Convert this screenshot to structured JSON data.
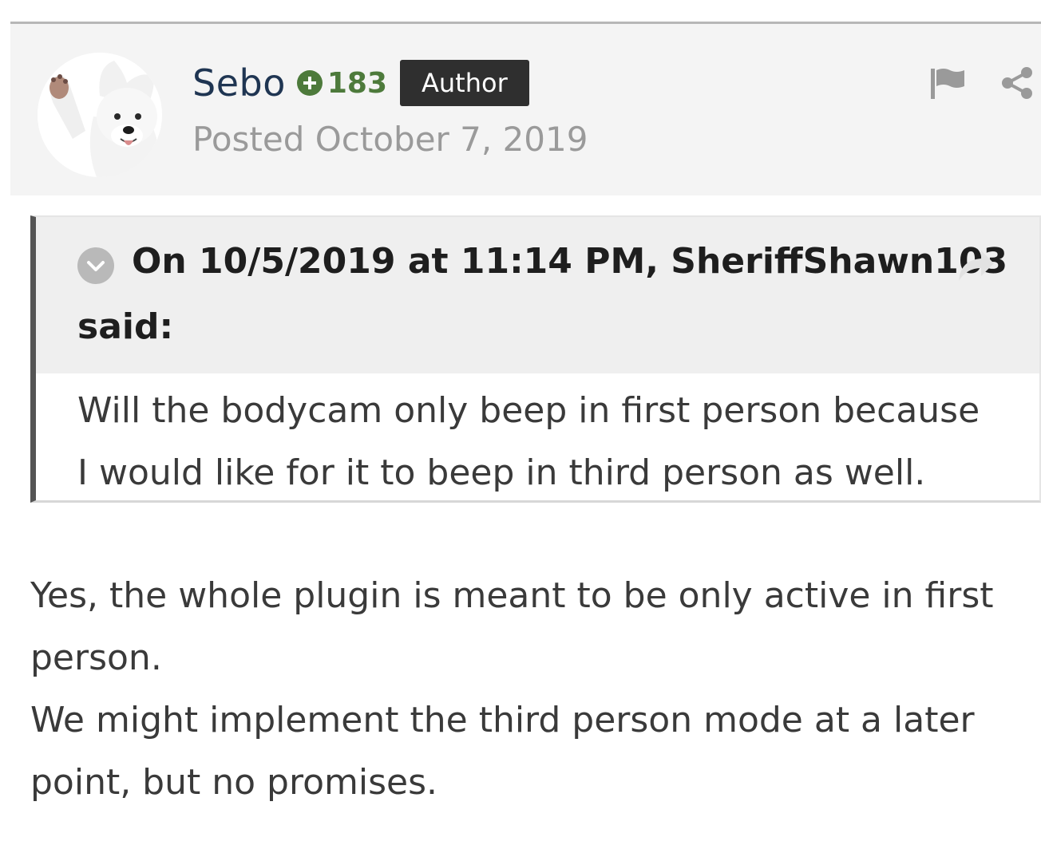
{
  "post": {
    "author": {
      "name": "Sebo",
      "reputation": "183",
      "badge": "Author",
      "avatar_icon": "samoyed-dog-avatar"
    },
    "posted_label": "Posted October 7, 2019",
    "actions": {
      "report_icon": "flag-icon",
      "share_icon": "share-icon"
    },
    "quote": {
      "citation_line1": "On 10/5/2019 at 11:14 PM, SheriffShawn103",
      "citation_line2": "said:",
      "toggle_icon": "chevron-down-icon",
      "jump_icon": "reply-arrow-icon",
      "lines": [
        "Will the bodycam only beep in first person because",
        "I would like for it to beep in third person as well."
      ]
    },
    "body": {
      "paragraph1_line1": "Yes, the whole plugin is meant to be only active in first",
      "paragraph1_line2": "person.",
      "paragraph2_line1": "We might implement the third person mode at a later",
      "paragraph2_line2": "point, but no promises."
    }
  },
  "colors": {
    "author_name": "#1f3552",
    "reputation": "#4d7a3b",
    "badge_bg": "#2f2f2f",
    "header_bg": "#f4f4f4",
    "quote_bar": "#555555"
  }
}
